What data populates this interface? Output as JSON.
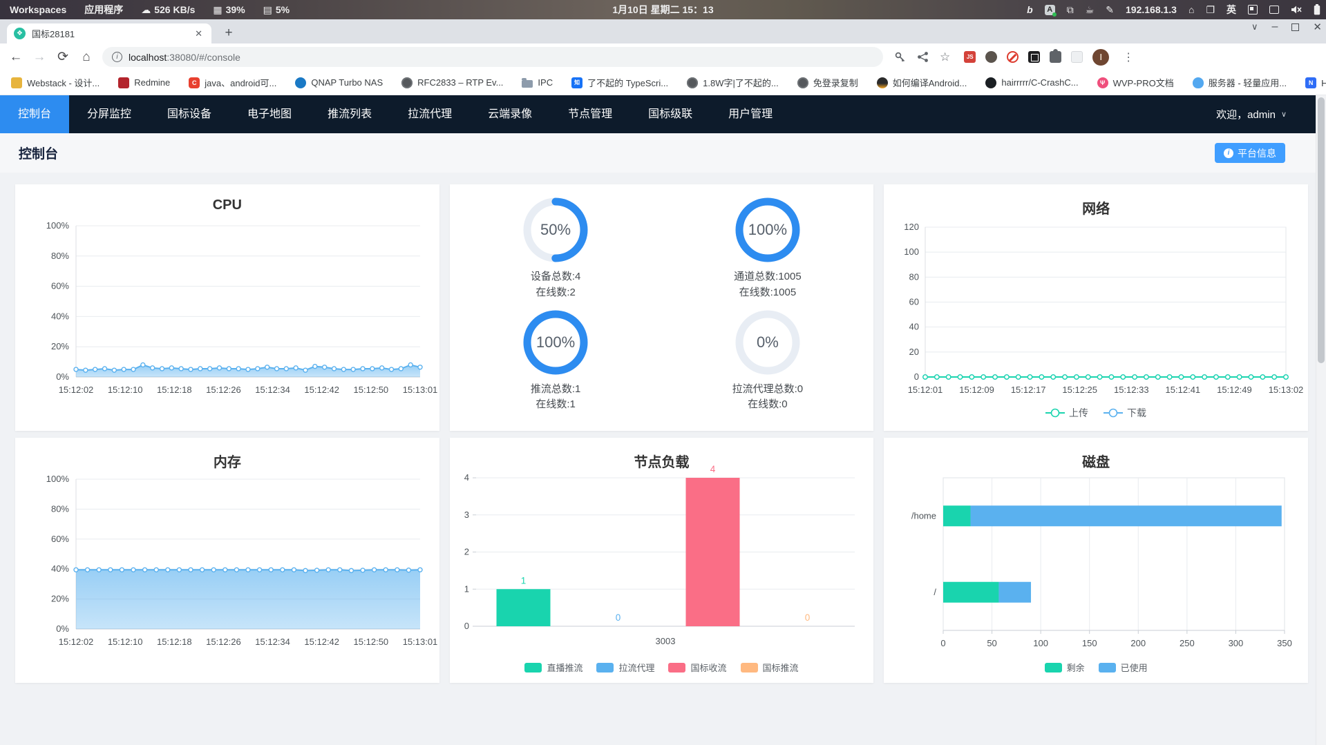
{
  "system_bar": {
    "workspaces_label": "Workspaces",
    "apps_label": "应用程序",
    "net_speed": "526 KB/s",
    "cpu_usage": "39%",
    "mem_usage": "5%",
    "clock": "1月10日 星期二  15：13",
    "ip_address": "192.168.1.3",
    "input_lang": "英"
  },
  "browser": {
    "tab_title": "国标28181",
    "url_host": "localhost",
    "url_path": ":38080/#/console",
    "bookmarks": [
      {
        "icon": "webstack-icon",
        "label": "Webstack - 设计..."
      },
      {
        "icon": "redmine-icon",
        "label": "Redmine"
      },
      {
        "icon": "csdn-icon",
        "glyph": "C",
        "label": "java、android可..."
      },
      {
        "icon": "qnap-icon",
        "label": "QNAP Turbo NAS"
      },
      {
        "icon": "globe-dark-icon",
        "label": "RFC2833 – RTP Ev..."
      },
      {
        "icon": "folder-icon",
        "label": "IPC"
      },
      {
        "icon": "zhihu-icon",
        "glyph": "知",
        "label": "了不起的 TypeScri..."
      },
      {
        "icon": "globe-dark-icon",
        "label": "1.8W字|了不起的..."
      },
      {
        "icon": "globe-dark-icon",
        "label": "免登录复制"
      },
      {
        "icon": "tux-icon",
        "label": "如何编译Android..."
      },
      {
        "icon": "github-icon",
        "label": "hairrrrr/C-CrashC..."
      },
      {
        "icon": "wvp-icon",
        "glyph": "Ψ",
        "label": "WVP-PRO文档"
      },
      {
        "icon": "cloud-icon",
        "label": "服务器 - 轻量应用..."
      },
      {
        "icon": "hdatmos-icon",
        "glyph": "N",
        "label": "HDAtmos :: 种子 *..."
      }
    ],
    "bookmarks_overflow": "»"
  },
  "nav": {
    "items": [
      "控制台",
      "分屏监控",
      "国标设备",
      "电子地图",
      "推流列表",
      "拉流代理",
      "云端录像",
      "节点管理",
      "国标级联",
      "用户管理"
    ],
    "active_index": 0,
    "welcome": "欢迎，admin"
  },
  "page": {
    "title": "控制台",
    "platform_info_button": "平台信息"
  },
  "chart_data": [
    {
      "id": "cpu",
      "type": "area",
      "title": "CPU",
      "x_labels": [
        "15:12:02",
        "15:12:10",
        "15:12:18",
        "15:12:26",
        "15:12:34",
        "15:12:42",
        "15:12:50",
        "15:13:01"
      ],
      "yticks": [
        "0%",
        "20%",
        "40%",
        "60%",
        "80%",
        "100%"
      ],
      "ymax": 100,
      "line_color": "#5ab1ef",
      "values": [
        5,
        4.5,
        5,
        5.5,
        4.5,
        5,
        5,
        8,
        6,
        5.5,
        6,
        5.5,
        5,
        5.5,
        5.5,
        6,
        5.5,
        5.5,
        5,
        5.5,
        6.5,
        5.5,
        5.5,
        6,
        4.5,
        7,
        6.5,
        5.5,
        5,
        5,
        5.5,
        5.5,
        6,
        5,
        5.5,
        8,
        6.5
      ]
    },
    {
      "id": "stats",
      "type": "rings",
      "ring_color": "#2d8cf0",
      "track_color": "#e8edf4",
      "items": [
        {
          "percent": 50,
          "line1": "设备总数:4",
          "line2": "在线数:2"
        },
        {
          "percent": 100,
          "line1": "通道总数:1005",
          "line2": "在线数:1005"
        },
        {
          "percent": 100,
          "line1": "推流总数:1",
          "line2": "在线数:1"
        },
        {
          "percent": 0,
          "line1": "拉流代理总数:0",
          "line2": "在线数:0"
        }
      ]
    },
    {
      "id": "network",
      "type": "line",
      "title": "网络",
      "x_labels": [
        "15:12:01",
        "15:12:09",
        "15:12:17",
        "15:12:25",
        "15:12:33",
        "15:12:41",
        "15:12:49",
        "15:13:02"
      ],
      "yticks": [
        "0",
        "20",
        "40",
        "60",
        "80",
        "100",
        "120"
      ],
      "ymax": 120,
      "series": [
        {
          "name": "上传",
          "color": "#19d4ae",
          "values": [
            0,
            0,
            0,
            0,
            0,
            0,
            0,
            0,
            0,
            0,
            0,
            0,
            0,
            0,
            0,
            0,
            0,
            0,
            0,
            0,
            0,
            0,
            0,
            0,
            0,
            0,
            0,
            0,
            0,
            0,
            0,
            0
          ]
        },
        {
          "name": "下载",
          "color": "#5ab1ef",
          "values": [
            0,
            0,
            0,
            0,
            0,
            0,
            0,
            0,
            0,
            0,
            0,
            0,
            0,
            0,
            0,
            0,
            0,
            0,
            0,
            0,
            0,
            0,
            0,
            0,
            0,
            0,
            0,
            0,
            0,
            0,
            0,
            0
          ]
        }
      ]
    },
    {
      "id": "memory",
      "type": "area",
      "title": "内存",
      "x_labels": [
        "15:12:02",
        "15:12:10",
        "15:12:18",
        "15:12:26",
        "15:12:34",
        "15:12:42",
        "15:12:50",
        "15:13:01"
      ],
      "yticks": [
        "0%",
        "20%",
        "40%",
        "60%",
        "80%",
        "100%"
      ],
      "ymax": 100,
      "line_color": "#5ab1ef",
      "values": [
        39.5,
        39.5,
        39.5,
        39.5,
        39.5,
        39.5,
        39.5,
        39.5,
        39.5,
        39.5,
        39.5,
        39.5,
        39.5,
        39.5,
        39.5,
        39.5,
        39.5,
        39.5,
        39.5,
        39.5,
        39,
        39.2,
        39.5,
        39.5,
        39,
        39.2,
        39.5,
        39.5,
        39.5,
        39.3,
        39.5
      ]
    },
    {
      "id": "node_load",
      "type": "bar",
      "title": "节点负载",
      "category": "3003",
      "yticks": [
        "0",
        "1",
        "2",
        "3",
        "4"
      ],
      "ymax": 4,
      "series": [
        {
          "name": "直播推流",
          "value": 1,
          "color": "#19d4ae"
        },
        {
          "name": "拉流代理",
          "value": 0,
          "color": "#5ab1ef"
        },
        {
          "name": "国标收流",
          "value": 4,
          "color": "#fa6e86"
        },
        {
          "name": "国标推流",
          "value": 0,
          "color": "#ffb980"
        }
      ]
    },
    {
      "id": "disk",
      "type": "hbar",
      "title": "磁盘",
      "categories": [
        "/home",
        "/"
      ],
      "xticks": [
        0,
        50,
        100,
        150,
        200,
        250,
        300,
        350
      ],
      "xmax": 350,
      "series": [
        {
          "name": "剩余",
          "color": "#19d4ae",
          "values": [
            28,
            57
          ]
        },
        {
          "name": "已使用",
          "color": "#5ab1ef",
          "values": [
            319,
            33
          ]
        }
      ]
    }
  ]
}
